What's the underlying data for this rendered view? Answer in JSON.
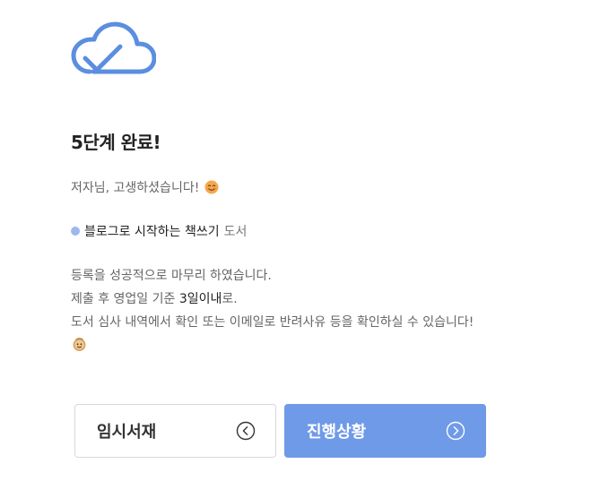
{
  "header": {
    "icon": "cloud-check-icon",
    "title": "5단계 완료!"
  },
  "greeting": {
    "text": "저자님, 고생하셨습니다!",
    "emoji": "😊"
  },
  "book": {
    "title": "블로그로 시작하는 책쓰기",
    "suffix": "도서"
  },
  "message": {
    "line1": "등록을 성공적으로 마무리 하였습니다.",
    "line2_prefix": "제출 후 영업일 기준 ",
    "line2_strong": "3일이내",
    "line2_suffix": "로.",
    "line3": "도서 심사 내역에서 확인 또는 이메일로 반려사유 등을 확인하실 수 있습니다!",
    "emoji": "cookie-icon"
  },
  "buttons": {
    "draft_label": "임시서재",
    "progress_label": "진행상황"
  },
  "colors": {
    "accent": "#6f9ae8",
    "bullet": "#9bb9ef"
  }
}
